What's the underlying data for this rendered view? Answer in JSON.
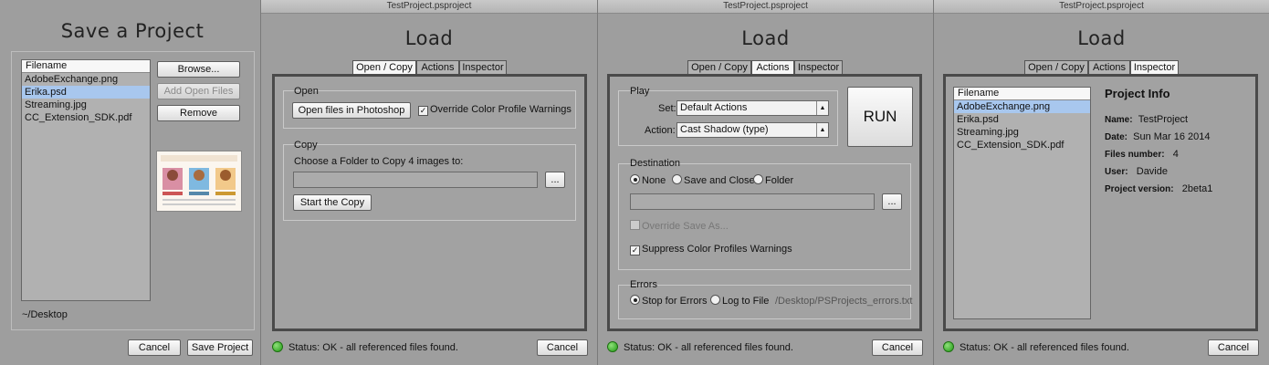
{
  "window_title": "TestProject.psproject",
  "save_panel": {
    "title": "Save a Project",
    "list_header": "Filename",
    "files": [
      "AdobeExchange.png",
      "Erika.psd",
      "Streaming.jpg",
      "CC_Extension_SDK.pdf"
    ],
    "selected_index": 1,
    "browse_label": "Browse...",
    "add_open_files_label": "Add Open Files",
    "remove_label": "Remove",
    "path": "~/Desktop",
    "cancel_label": "Cancel",
    "save_label": "Save Project"
  },
  "load_title": "Load",
  "tabs": [
    "Open / Copy",
    "Actions",
    "Inspector"
  ],
  "status_text": "Status: OK - all referenced files found.",
  "cancel_label": "Cancel",
  "open_copy": {
    "open_group": "Open",
    "open_button": "Open files in Photoshop",
    "override_label": "Override Color Profile Warnings",
    "copy_group": "Copy",
    "copy_prompt": "Choose a Folder to Copy 4 images to:",
    "browse_label": "...",
    "start_copy_label": "Start the Copy"
  },
  "actions": {
    "play_group": "Play",
    "set_label": "Set:",
    "set_value": "Default Actions",
    "action_label": "Action:",
    "action_value": "Cast Shadow (type)",
    "run_label": "RUN",
    "destination_group": "Destination",
    "dest_none": "None",
    "dest_save_close": "Save and Close",
    "dest_folder": "Folder",
    "browse_label": "...",
    "override_save_as": "Override Save As...",
    "suppress_label": "Suppress Color Profiles Warnings",
    "errors_group": "Errors",
    "stop_for_errors": "Stop for Errors",
    "log_to_file": "Log to File",
    "log_path": "/Desktop/PSProjects_errors.txt"
  },
  "inspector": {
    "list_header": "Filename",
    "files": [
      "AdobeExchange.png",
      "Erika.psd",
      "Streaming.jpg",
      "CC_Extension_SDK.pdf"
    ],
    "selected_index": 0,
    "info_title": "Project Info",
    "name_key": "Name:",
    "name_val": "TestProject",
    "date_key": "Date:",
    "date_val": "Sun Mar 16 2014",
    "files_key": "Files number:",
    "files_val": "4",
    "user_key": "User:",
    "user_val": "Davide",
    "version_key": "Project version:",
    "version_val": "2beta1"
  },
  "colors": {
    "status_ok": "#2aa51a",
    "selection": "#a8c7ee",
    "active_tab": "#f6f6f6"
  },
  "icons": {
    "status": "green-dot-icon",
    "checkbox": "checkmark-icon",
    "dropdown": "chevron-down-icon"
  }
}
